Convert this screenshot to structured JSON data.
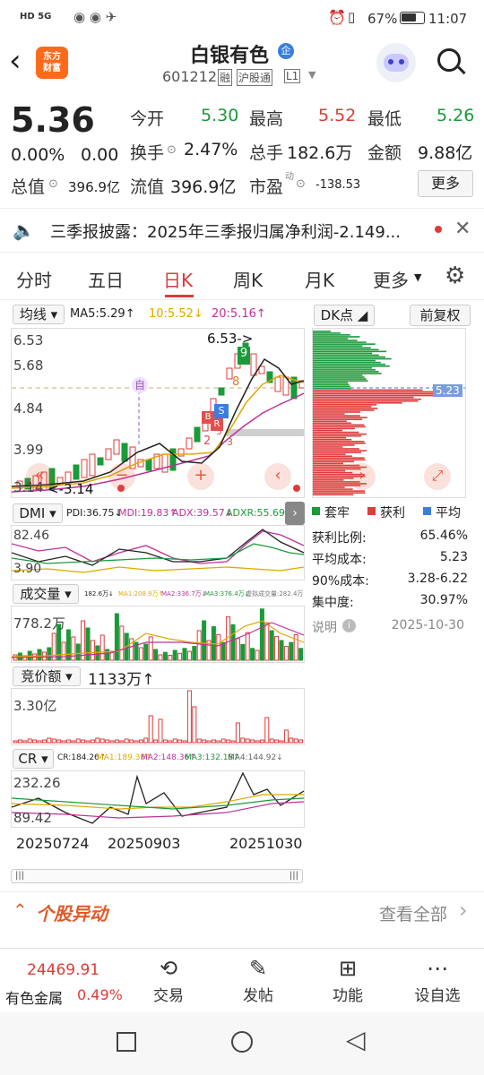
{
  "status": {
    "left": "HD 5G",
    "battery_pct": "67%",
    "time": "11:07"
  },
  "header": {
    "title": "白银有色",
    "badge": "企",
    "code": "601212",
    "tags": [
      "融",
      "沪股通",
      "L1"
    ],
    "logo_text": "东方\n财富"
  },
  "quote": {
    "price": "5.36",
    "change_pct": "0.00%",
    "change": "0.00",
    "rows": [
      [
        {
          "label": "今开",
          "value": "5.30",
          "color": "green"
        },
        {
          "label": "最高",
          "value": "5.52",
          "color": "red"
        },
        {
          "label": "最低",
          "value": "5.26",
          "color": "green"
        }
      ],
      [
        {
          "label": "换手",
          "value": "2.47%",
          "color": "dark"
        },
        {
          "label": "总手",
          "value": "182.6万",
          "color": "dark"
        },
        {
          "label": "金额",
          "value": "9.88亿",
          "color": "dark"
        }
      ]
    ],
    "total_value_label": "总值",
    "total_value": "396.9亿",
    "float_value_label": "流值",
    "float_value": "396.9亿",
    "pe_label": "市盈",
    "pe_sup": "动",
    "pe_value": "-138.53",
    "more_button": "更多"
  },
  "notice": {
    "text": "三季报披露：2025年三季报归属净利润-2.149..."
  },
  "tabs": [
    {
      "label": "分时"
    },
    {
      "label": "五日"
    },
    {
      "label": "日K",
      "active": true
    },
    {
      "label": "周K"
    },
    {
      "label": "月K"
    },
    {
      "label": "更多"
    }
  ],
  "kline": {
    "ma_selector": "均线",
    "ma5": "MA5:5.29↑",
    "ma10": "10:5.52↓",
    "ma20": "20:5.16↑",
    "y_labels": [
      "6.53",
      "5.68",
      "4.84",
      "3.99",
      "3.14"
    ],
    "peak_annotation": "6.53->",
    "low_annotation": "<-3.14",
    "badges": {
      "self": "自",
      "b": "B",
      "s": "S",
      "nine": "9",
      "eight": "8",
      "three": "3",
      "five": "5",
      "two": "2",
      "r": "R",
      "d": "D"
    }
  },
  "dk": {
    "selector": "DK点",
    "restore": "前复权",
    "avg_label": "5.23",
    "legend": [
      "套牢",
      "获利",
      "平均"
    ],
    "stats": [
      {
        "label": "获利比例:",
        "value": "65.46%"
      },
      {
        "label": "平均成本:",
        "value": "5.23"
      },
      {
        "label": "90%成本:",
        "value": "3.28-6.22"
      },
      {
        "label": "集中度:",
        "value": "30.97%"
      }
    ],
    "note_label": "说明",
    "note_date": "2025-10-30"
  },
  "dmi": {
    "selector": "DMI",
    "pdi": "PDI:36.75↓",
    "mdi": "MDI:19.83↑",
    "adx": "ADX:39.57↓",
    "adxr": "ADXR:55.69↓",
    "y_top": "82.46",
    "y_bot": "3.90"
  },
  "volume": {
    "selector": "成交量",
    "v1": "182.6万↓",
    "ma1": "MA1:208.9万↑",
    "ma2": "MA2:336.7万↓",
    "ma3": "MA3:376.4万↓",
    "ma4": "虚拟成交量:282.4万",
    "y_top": "778.2万"
  },
  "auction": {
    "selector": "竞价额",
    "value": "1133万↑",
    "y_top": "3.30亿"
  },
  "cr": {
    "selector": "CR",
    "cr": "CR:184.26↑",
    "ma1": "MA1:189.38↑",
    "ma2": "MA2:148.36↑",
    "ma3": "MA3:132.18↑",
    "ma4": "MA4:144.92↓",
    "y_top": "232.26",
    "y_bot": "89.42"
  },
  "dates": [
    "20250724",
    "20250903",
    "20251030"
  ],
  "section": {
    "title": "个股异动",
    "view_all": "查看全部"
  },
  "bottom": {
    "index_value": "24469.91",
    "index_name": "有色金属",
    "index_pct": "0.49%",
    "items": [
      {
        "label": "交易"
      },
      {
        "label": "发帖"
      },
      {
        "label": "功能"
      },
      {
        "label": "设自选"
      }
    ]
  }
}
